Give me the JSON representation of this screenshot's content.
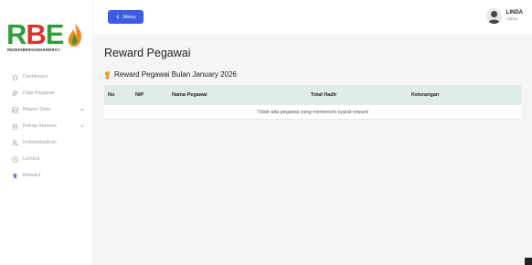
{
  "logo": {
    "brand": "RBE",
    "tagline": "REZEKIBERSAMAENERGY"
  },
  "sidebar": {
    "items": [
      {
        "label": "Dashboard",
        "icon": "home-icon"
      },
      {
        "label": "Data Pegawai",
        "icon": "users-icon"
      },
      {
        "label": "Master Data",
        "icon": "database-icon",
        "has_submenu": true
      },
      {
        "label": "Rekap Absensi",
        "icon": "clipboard-icon",
        "has_submenu": true
      },
      {
        "label": "Ketidakhadiran",
        "icon": "user-x-icon"
      },
      {
        "label": "Lembur",
        "icon": "clock-icon"
      },
      {
        "label": "Reward",
        "icon": "award-icon",
        "active": true
      }
    ]
  },
  "topbar": {
    "menu_label": "Menu"
  },
  "user": {
    "name": "LINDA",
    "role": "Admin"
  },
  "page": {
    "title": "Reward Pegawai",
    "section_title": "Reward Pegawai Bulan January 2026"
  },
  "table": {
    "headers": [
      "No",
      "NIP",
      "Nama Pegawai",
      "Total Hadir",
      "Keterangan"
    ],
    "empty_message": "Tidak ada pegawai yang memenuhi syarat reward"
  },
  "colors": {
    "accent": "#3b5be8",
    "table_header": "#e0ece7",
    "brand_green": "#2e9d3a",
    "brand_red": "#d9342b"
  }
}
